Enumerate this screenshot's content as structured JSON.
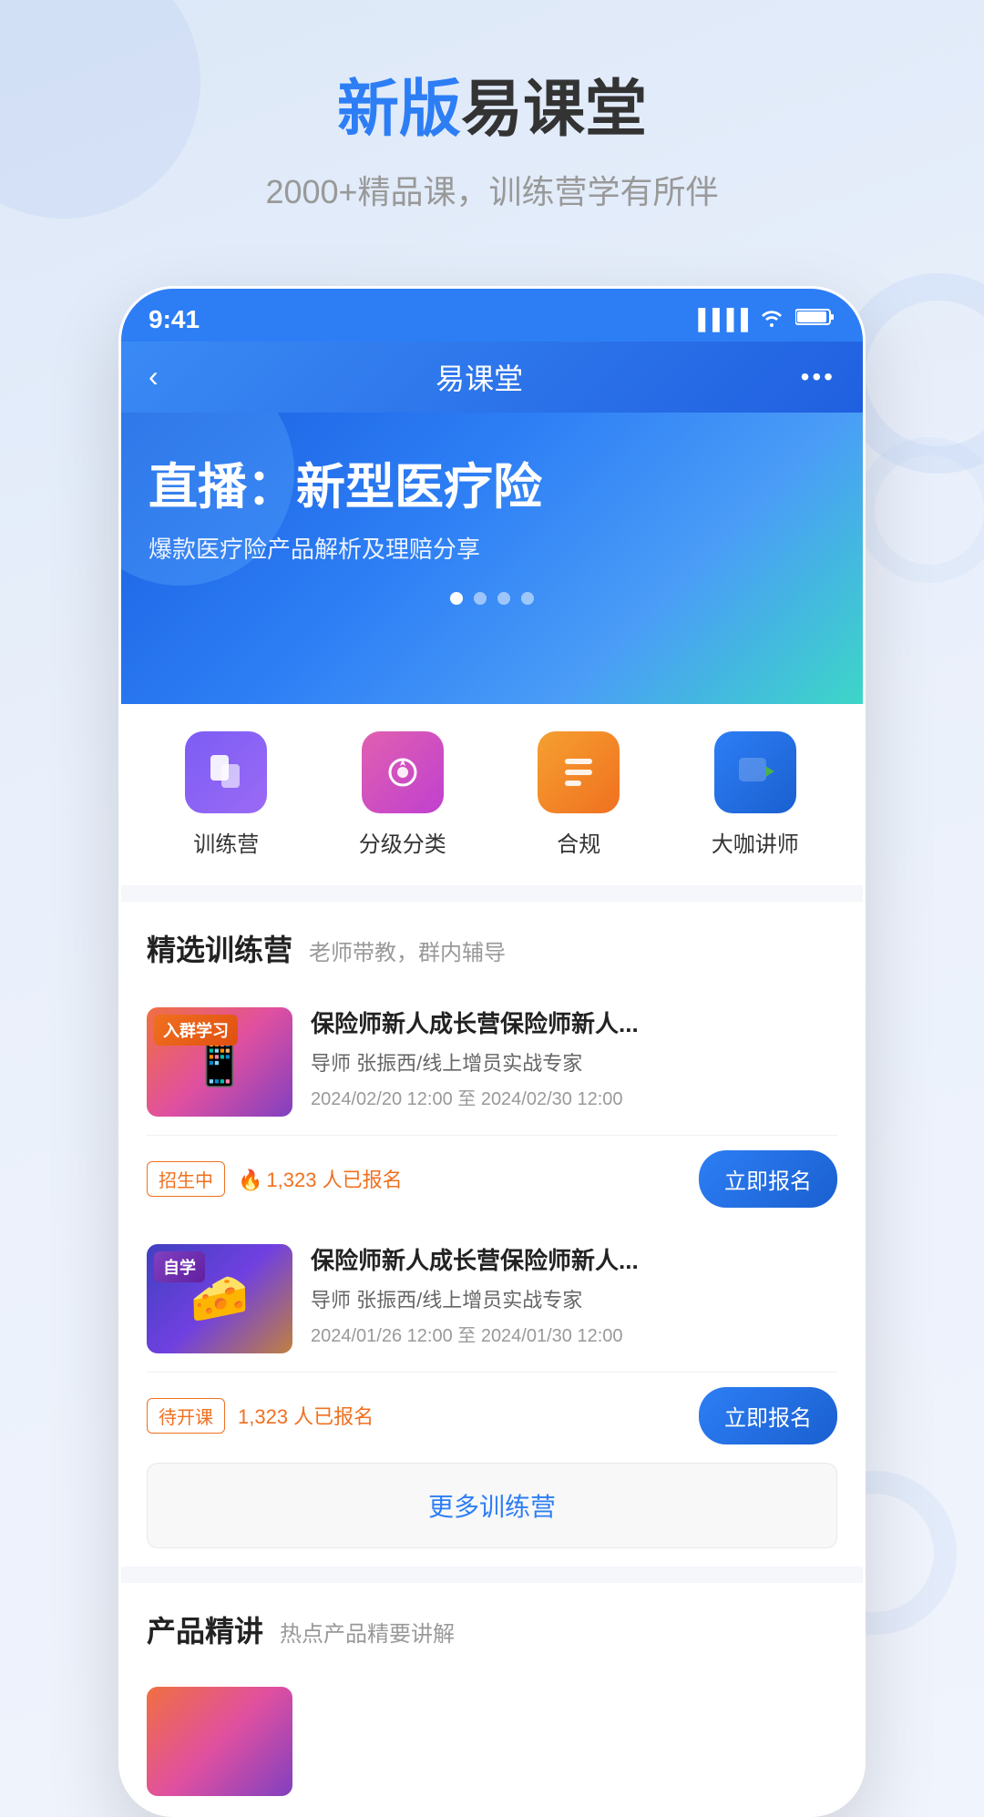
{
  "app": {
    "title_blue": "新版",
    "title_rest": "易课堂",
    "subtitle": "2000+精品课，训练营学有所伴"
  },
  "phone": {
    "status_time": "9:41",
    "nav_title": "易课堂"
  },
  "banner": {
    "title": "直播：新型医疗险",
    "subtitle": "爆款医疗险产品解析及理赔分享",
    "dots": [
      true,
      false,
      false,
      false
    ]
  },
  "categories": [
    {
      "label": "训练营",
      "icon_type": "purple"
    },
    {
      "label": "分级分类",
      "icon_type": "pink"
    },
    {
      "label": "合规",
      "icon_type": "orange"
    },
    {
      "label": "大咖讲师",
      "icon_type": "blue"
    }
  ],
  "training_section": {
    "title": "精选训练营",
    "desc": "老师带教，群内辅导",
    "more_btn": "更多训练营",
    "courses": [
      {
        "badge": "入群学习",
        "badge_type": "group",
        "title": "保险师新人成长营保险师新人...",
        "teacher": "导师 张振西/线上增员实战专家",
        "date": "2024/02/20 12:00 至 2024/02/30 12:00",
        "tag": "招生中",
        "tag_type": "recruiting",
        "enrolled": "1,323 人已报名",
        "btn": "立即报名"
      },
      {
        "badge": "自学",
        "badge_type": "self",
        "title": "保险师新人成长营保险师新人...",
        "teacher": "导师 张振西/线上增员实战专家",
        "date": "2024/01/26 12:00 至 2024/01/30 12:00",
        "tag": "待开课",
        "tag_type": "pending",
        "enrolled": "1,323 人已报名",
        "btn": "立即报名"
      }
    ]
  },
  "product_section": {
    "title": "产品精讲",
    "desc": "热点产品精要讲解"
  }
}
